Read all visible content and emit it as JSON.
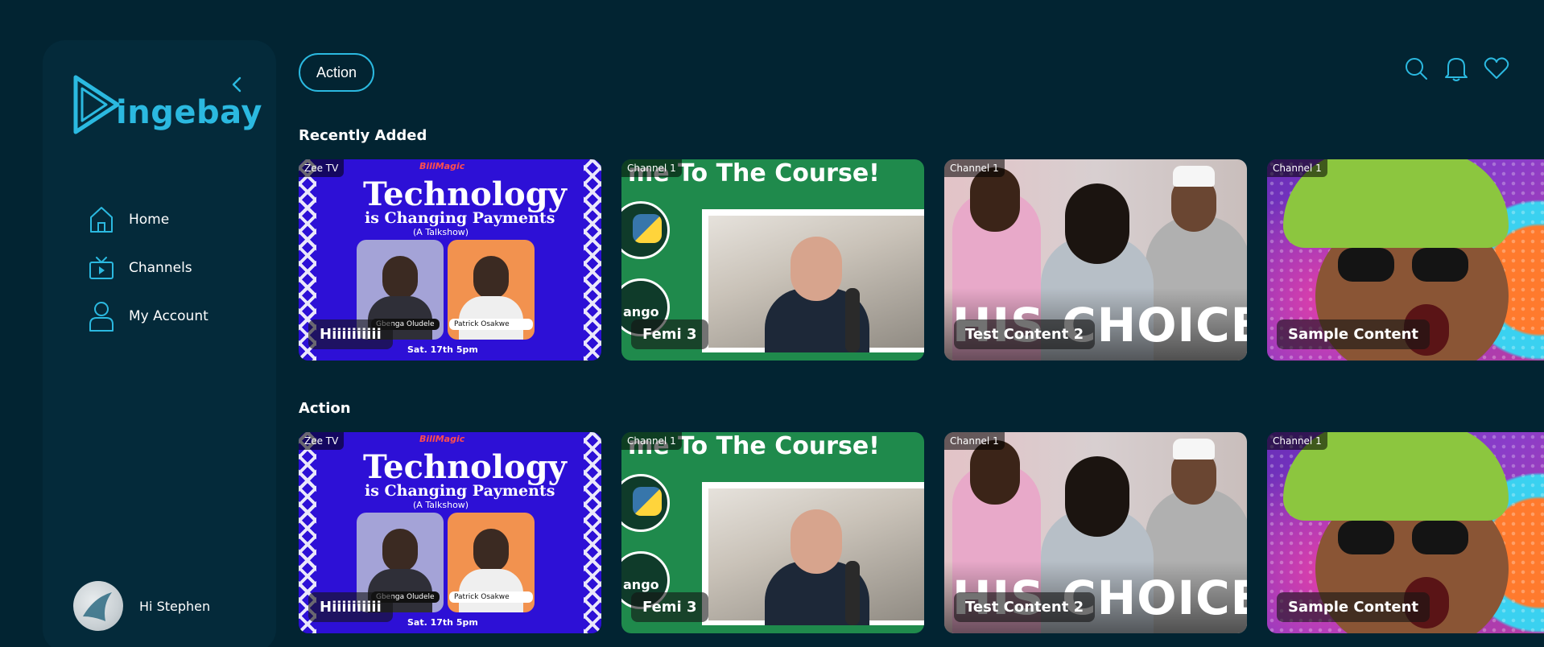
{
  "sidebar": {
    "logo_text": "ingebay",
    "nav": [
      {
        "label": "Home",
        "icon": "home-icon"
      },
      {
        "label": "Channels",
        "icon": "tv-icon"
      },
      {
        "label": "My Account",
        "icon": "user-icon"
      }
    ],
    "user": {
      "greeting": "Hi Stephen"
    }
  },
  "header": {
    "filter_chip": "Action",
    "icons": [
      "search-icon",
      "bell-icon",
      "heart-icon"
    ]
  },
  "sections": [
    {
      "title": "Recently Added",
      "cards": [
        {
          "channel": "Zee TV",
          "title": "Hiiiiiiiiii",
          "thumb": "tech"
        },
        {
          "channel": "Channel 1",
          "title": "Femi 3",
          "thumb": "course"
        },
        {
          "channel": "Channel 1",
          "title": "Test Content 2",
          "thumb": "choice"
        },
        {
          "channel": "Channel 1",
          "title": "Sample Content",
          "thumb": "sample"
        }
      ]
    },
    {
      "title": "Action",
      "cards": [
        {
          "channel": "Zee TV",
          "title": "Hiiiiiiiiii",
          "thumb": "tech"
        },
        {
          "channel": "Channel 1",
          "title": "Femi 3",
          "thumb": "course"
        },
        {
          "channel": "Channel 1",
          "title": "Test Content 2",
          "thumb": "choice"
        },
        {
          "channel": "Channel 1",
          "title": "Sample Content",
          "thumb": "sample"
        }
      ]
    }
  ],
  "thumbs": {
    "tech": {
      "brand": "BillMagic",
      "line1": "Technology",
      "line2": "is Changing Payments",
      "line3": "(A Talkshow)",
      "guest1": "Gbenga Oludele",
      "guest2": "Patrick Osakwe",
      "bottom": "Sat. 17th   5pm"
    },
    "course": {
      "banner": "me To The Course!",
      "side": "ango"
    },
    "choice": {
      "big": "HIS CHOICE"
    }
  },
  "colors": {
    "background": "#022432",
    "sidebar": "#042a3a",
    "accent": "#2bb9e0"
  }
}
